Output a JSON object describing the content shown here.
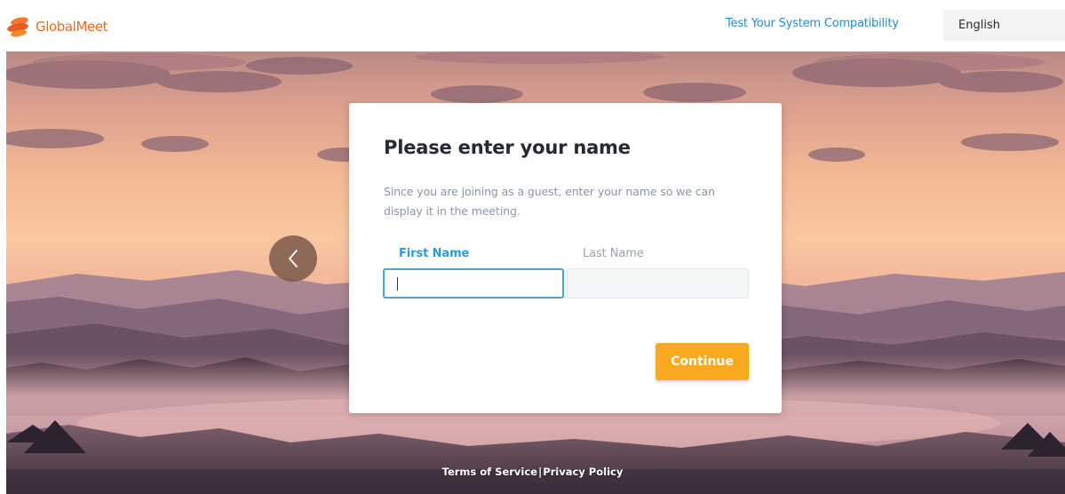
{
  "header": {
    "logo_text": "GlobalMeet",
    "logo_icon": "globalmeet-logo-icon",
    "compat_link": "Test Your System Compatibility",
    "language": "English"
  },
  "dialog": {
    "title": "Please enter your name",
    "description": "Since you are joining as a guest, enter your name so we can display it in the meeting.",
    "first_name_label": "First Name",
    "last_name_label": "Last Name",
    "first_name_value": "",
    "last_name_value": "",
    "continue_label": "Continue"
  },
  "nav": {
    "back_icon": "chevron-left-icon"
  },
  "footer": {
    "terms": "Terms of Service",
    "separator": "|",
    "privacy": "Privacy Policy"
  },
  "colors": {
    "brand_orange": "#ee6b24",
    "link_blue": "#1f8fd1",
    "focus_blue": "#3fa9dc",
    "continue_button": "#fbaa1f"
  }
}
